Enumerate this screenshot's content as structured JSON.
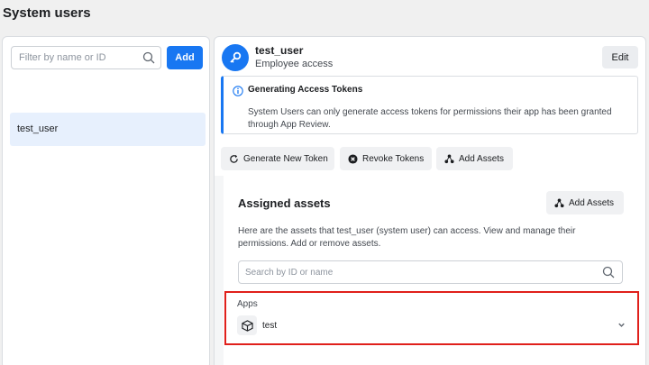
{
  "header": {
    "title": "System users"
  },
  "sidebar": {
    "filter_placeholder": "Filter by name or ID",
    "add_label": "Add",
    "users": [
      {
        "name": "test_user"
      }
    ]
  },
  "user": {
    "name": "test_user",
    "role": "Employee access",
    "edit_label": "Edit"
  },
  "info": {
    "title": "Generating Access Tokens",
    "text": "System Users can only generate access tokens for permissions their app has been granted through App Review."
  },
  "actions": {
    "generate_label": "Generate New Token",
    "revoke_label": "Revoke Tokens",
    "add_assets_label": "Add Assets"
  },
  "assets": {
    "title": "Assigned assets",
    "add_assets_label": "Add Assets",
    "description": "Here are the assets that test_user (system user) can access. View and manage their permissions. Add or remove assets.",
    "search_placeholder": "Search by ID or name",
    "apps_label": "Apps",
    "apps": [
      {
        "name": "test",
        "icon": "cube-icon"
      }
    ]
  },
  "colors": {
    "accent": "#1877f2",
    "highlight": "#e0201b",
    "selected_bg": "#e7f0fd"
  }
}
